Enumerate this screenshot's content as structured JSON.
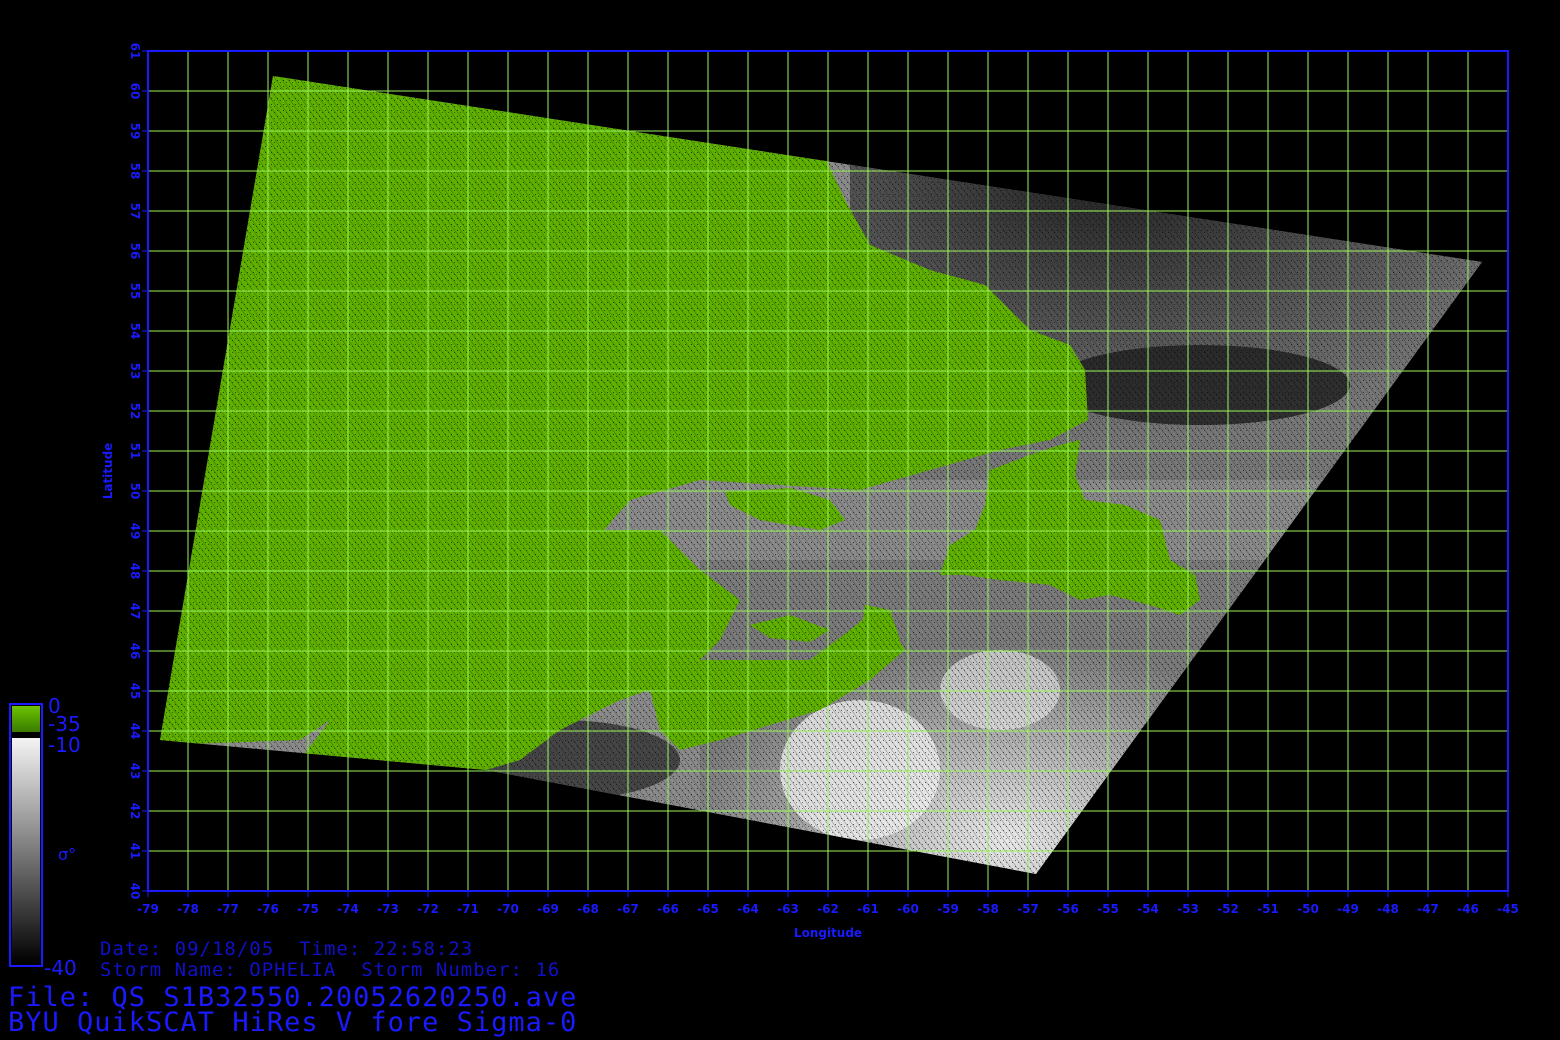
{
  "map": {
    "longitude_axis_title": "Longitude",
    "latitude_axis_title": "Latitude",
    "longitude_ticks": [
      "-79",
      "-78",
      "-77",
      "-76",
      "-75",
      "-74",
      "-73",
      "-72",
      "-71",
      "-70",
      "-69",
      "-68",
      "-67",
      "-66",
      "-65",
      "-64",
      "-63",
      "-62",
      "-61",
      "-60",
      "-59",
      "-58",
      "-57",
      "-56",
      "-55",
      "-54",
      "-53",
      "-52",
      "-51",
      "-50",
      "-49",
      "-48",
      "-47",
      "-46",
      "-45"
    ],
    "latitude_ticks": [
      "40",
      "41",
      "42",
      "43",
      "44",
      "45",
      "46",
      "47",
      "48",
      "49",
      "50",
      "51",
      "52",
      "53",
      "54",
      "55",
      "56",
      "57",
      "58",
      "59",
      "60",
      "61"
    ],
    "lon_range": [
      -79,
      -45
    ],
    "lat_range": [
      40,
      61
    ],
    "grid": true,
    "colors": {
      "frame": "#1a1aff",
      "grid": "#9af55a",
      "land": "#5fb000",
      "ocean_dark": "#2e2e2e",
      "ocean_light": "#d8d8d8"
    }
  },
  "colorbar": {
    "land_top_label": "0",
    "land_bottom_label": "-35",
    "ocean_top_label": "-10",
    "ocean_bottom_label": "-40",
    "symbol": "σ°"
  },
  "info": {
    "date_label": "Date:",
    "date": "09/18/05",
    "time_label": "Time:",
    "time": "22:58:23",
    "storm_name_label": "Storm Name:",
    "storm_name": "OPHELIA",
    "storm_number_label": "Storm Number:",
    "storm_number": "16",
    "file_label": "File:",
    "file_name": "QS_S1B32550.20052620250.ave",
    "product": "BYU QuikSCAT HiRes V fore Sigma-0"
  }
}
